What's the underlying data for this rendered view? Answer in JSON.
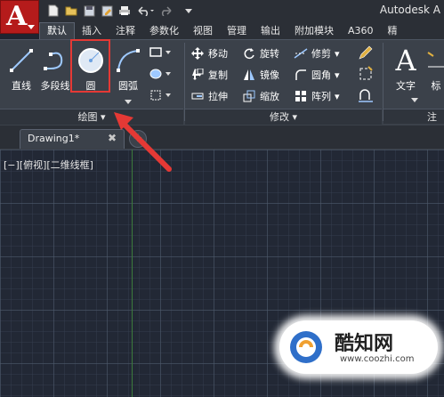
{
  "app": {
    "title": "Autodesk A",
    "menu_letter": "A"
  },
  "qat_icons": [
    "new-icon",
    "open-icon",
    "save-icon",
    "saveas-icon",
    "print-icon",
    "undo-icon",
    "redo-icon",
    "dropdown-icon"
  ],
  "tabs": [
    {
      "label": "默认",
      "active": true
    },
    {
      "label": "插入"
    },
    {
      "label": "注释"
    },
    {
      "label": "参数化"
    },
    {
      "label": "视图"
    },
    {
      "label": "管理"
    },
    {
      "label": "输出"
    },
    {
      "label": "附加模块"
    },
    {
      "label": "A360"
    },
    {
      "label": "精"
    }
  ],
  "draw_panel": {
    "title": "绘图",
    "line": "直线",
    "polyline": "多段线",
    "circle": "圆",
    "arc": "圆弧"
  },
  "modify_panel": {
    "title": "修改",
    "move": "移动",
    "rotate": "旋转",
    "trim": "修剪",
    "copy": "复制",
    "mirror": "镜像",
    "fillet": "圆角",
    "stretch": "拉伸",
    "scale": "缩放",
    "array": "阵列"
  },
  "annotation_panel": {
    "text": "文字",
    "dim": "标",
    "partial_title": "注"
  },
  "document": {
    "tab_label": "Drawing1*",
    "close": "✖",
    "add": "+"
  },
  "viewport_label": "[−][俯视][二维线框]",
  "watermark": {
    "name": "酷知网",
    "url": "www.coozhi.com"
  },
  "colors": {
    "accent_red": "#e53935",
    "app_red": "#b51b1b",
    "canvas": "#222835",
    "ribbon": "#3b414a"
  }
}
